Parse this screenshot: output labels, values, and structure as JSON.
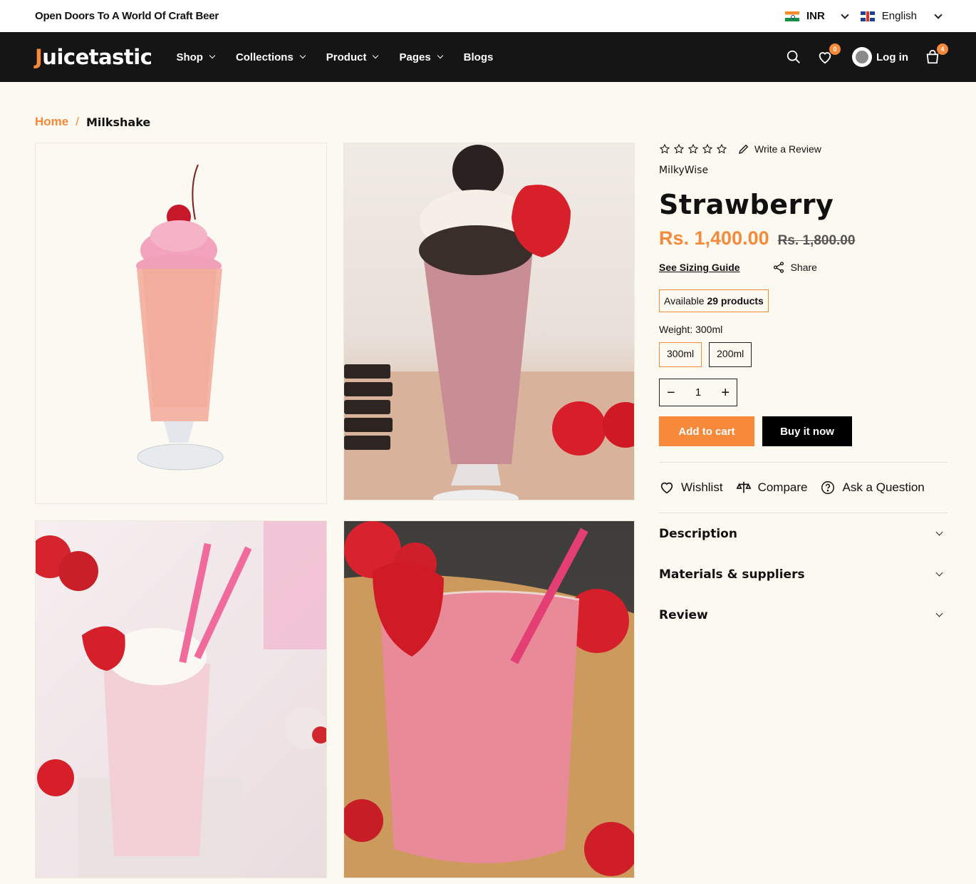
{
  "topbar": {
    "message": "Open Doors To A World Of Craft Beer",
    "currency": "INR",
    "language": "English"
  },
  "header": {
    "logo_first": "J",
    "logo_rest": "uicetastic",
    "nav": [
      {
        "label": "Shop",
        "has_dropdown": true
      },
      {
        "label": "Collections",
        "has_dropdown": true
      },
      {
        "label": "Product",
        "has_dropdown": true
      },
      {
        "label": "Pages",
        "has_dropdown": true
      },
      {
        "label": "Blogs",
        "has_dropdown": false
      }
    ],
    "wishlist_count": "0",
    "login_label": "Log in",
    "cart_count": "4"
  },
  "breadcrumb": {
    "home": "Home",
    "separator": "/",
    "current": "Milkshake"
  },
  "product": {
    "rating": 0,
    "review_link": "Write a Review",
    "vendor": "MilkyWise",
    "title": "Strawberry",
    "price": "Rs. 1,400.00",
    "compare_price": "Rs. 1,800.00",
    "sizing_guide": "See Sizing Guide",
    "share": "Share",
    "availability_prefix": "Available",
    "availability_count": "29 products",
    "weight_label": "Weight: 300ml",
    "variants": [
      "300ml",
      "200ml"
    ],
    "selected_variant": "300ml",
    "quantity": "1",
    "add_to_cart": "Add to cart",
    "buy_now": "Buy it now",
    "actions": [
      "Wishlist",
      "Compare",
      "Ask a Question"
    ],
    "accordions": [
      "Description",
      "Materials & suppliers",
      "Review"
    ]
  },
  "colors": {
    "accent": "#f6893a",
    "header_bg": "#151515",
    "page_bg": "#fcf9f1"
  },
  "icons": [
    "search-icon",
    "heart-icon",
    "user-icon",
    "cart-icon",
    "star-icon",
    "pencil-icon",
    "share-icon",
    "compare-icon",
    "question-icon",
    "chevron-down-icon"
  ]
}
